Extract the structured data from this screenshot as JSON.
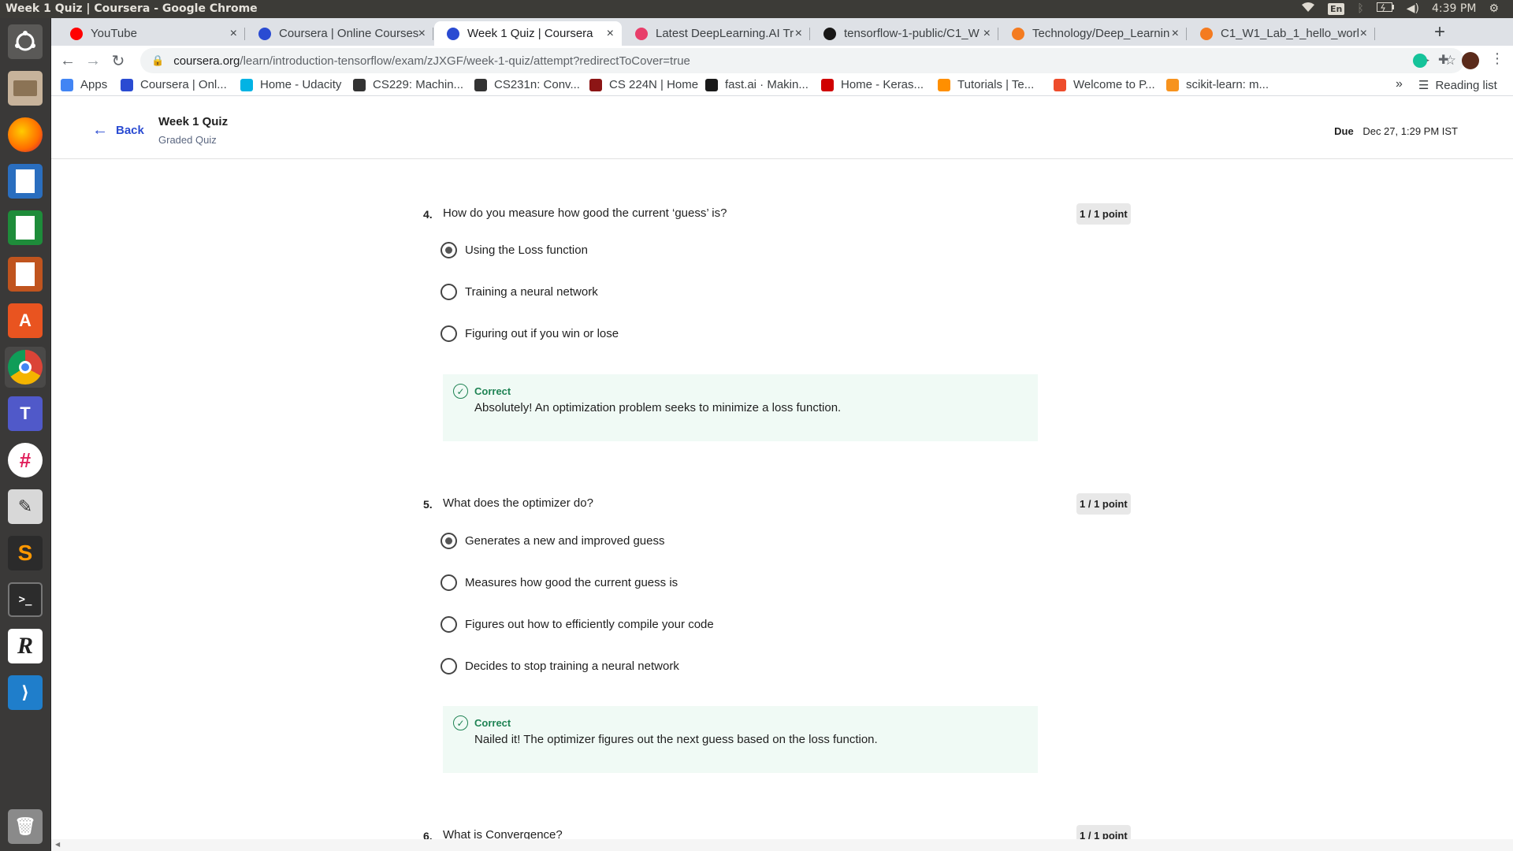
{
  "os": {
    "window_title": "Week 1 Quiz | Coursera - Google Chrome",
    "lang": "En",
    "clock": "4:39 PM"
  },
  "browser": {
    "tabs": [
      {
        "label": "YouTube",
        "favicon_color": "#ff0000"
      },
      {
        "label": "Coursera | Online Courses",
        "favicon_color": "#2a4bd2"
      },
      {
        "label": "Week 1 Quiz | Coursera",
        "favicon_color": "#2a4bd2",
        "active": true
      },
      {
        "label": "Latest DeepLearning.AI Tr",
        "favicon_color": "#e83e6a"
      },
      {
        "label": "tensorflow-1-public/C1_W",
        "favicon_color": "#181717"
      },
      {
        "label": "Technology/Deep_Learnin",
        "favicon_color": "#f47b20"
      },
      {
        "label": "C1_W1_Lab_1_hello_worl",
        "favicon_color": "#f47b20"
      }
    ],
    "url_host": "coursera.org",
    "url_path": "/learn/introduction-tensorflow/exam/zJXGF/week-1-quiz/attempt?redirectToCover=true",
    "bookmarks": [
      {
        "label": "Apps",
        "icon": "apps-grid-icon",
        "color": "#4285f4"
      },
      {
        "label": "Coursera | Onl...",
        "icon": "coursera-icon",
        "color": "#2a4bd2"
      },
      {
        "label": "Home - Udacity",
        "icon": "udacity-icon",
        "color": "#02b3e4"
      },
      {
        "label": "CS229: Machin...",
        "icon": "cs229-icon",
        "color": "#333333"
      },
      {
        "label": "CS231n: Conv...",
        "icon": "cs231n-icon",
        "color": "#333333"
      },
      {
        "label": "CS 224N | Home",
        "icon": "stanford-icon",
        "color": "#8c1515"
      },
      {
        "label": "fast.ai · Makin...",
        "icon": "fastai-icon",
        "color": "#1a1a1a"
      },
      {
        "label": "Home - Keras...",
        "icon": "keras-icon",
        "color": "#d00000"
      },
      {
        "label": "Tutorials | Te...",
        "icon": "tensorflow-icon",
        "color": "#ff8f00"
      },
      {
        "label": "Welcome to P...",
        "icon": "pytorch-icon",
        "color": "#ee4c2c"
      },
      {
        "label": "scikit-learn: m...",
        "icon": "scikit-learn-icon",
        "color": "#f7931e"
      }
    ],
    "reading_list": "Reading list"
  },
  "quiz": {
    "back": "Back",
    "title": "Week 1 Quiz",
    "subtitle": "Graded Quiz",
    "due_label": "Due",
    "due_value": "Dec 27, 1:29 PM IST",
    "questions": [
      {
        "number": "4.",
        "text": "How do you measure how good the current ‘guess’ is?",
        "score": "1 / 1 point",
        "options": [
          "Using the Loss function",
          "Training a neural network",
          "Figuring out if you win or lose"
        ],
        "selected": 0,
        "feedback_title": "Correct",
        "feedback_text": "Absolutely!  An optimization problem seeks to minimize a loss function."
      },
      {
        "number": "5.",
        "text": "What does the optimizer do?",
        "score": "1 / 1 point",
        "options": [
          "Generates a new and improved guess",
          "Measures how good the current guess is",
          "Figures out how to efficiently compile your code",
          "Decides to stop training a neural network"
        ],
        "selected": 0,
        "feedback_title": "Correct",
        "feedback_text": "Nailed it! The optimizer figures out the next guess based on the loss function."
      },
      {
        "number": "6.",
        "text": "What is Convergence?",
        "score": "1 / 1 point"
      }
    ]
  },
  "colors": {
    "accent": "#2a4bd2",
    "correct": "#1f8354",
    "feedback_bg": "#f0faf5"
  }
}
